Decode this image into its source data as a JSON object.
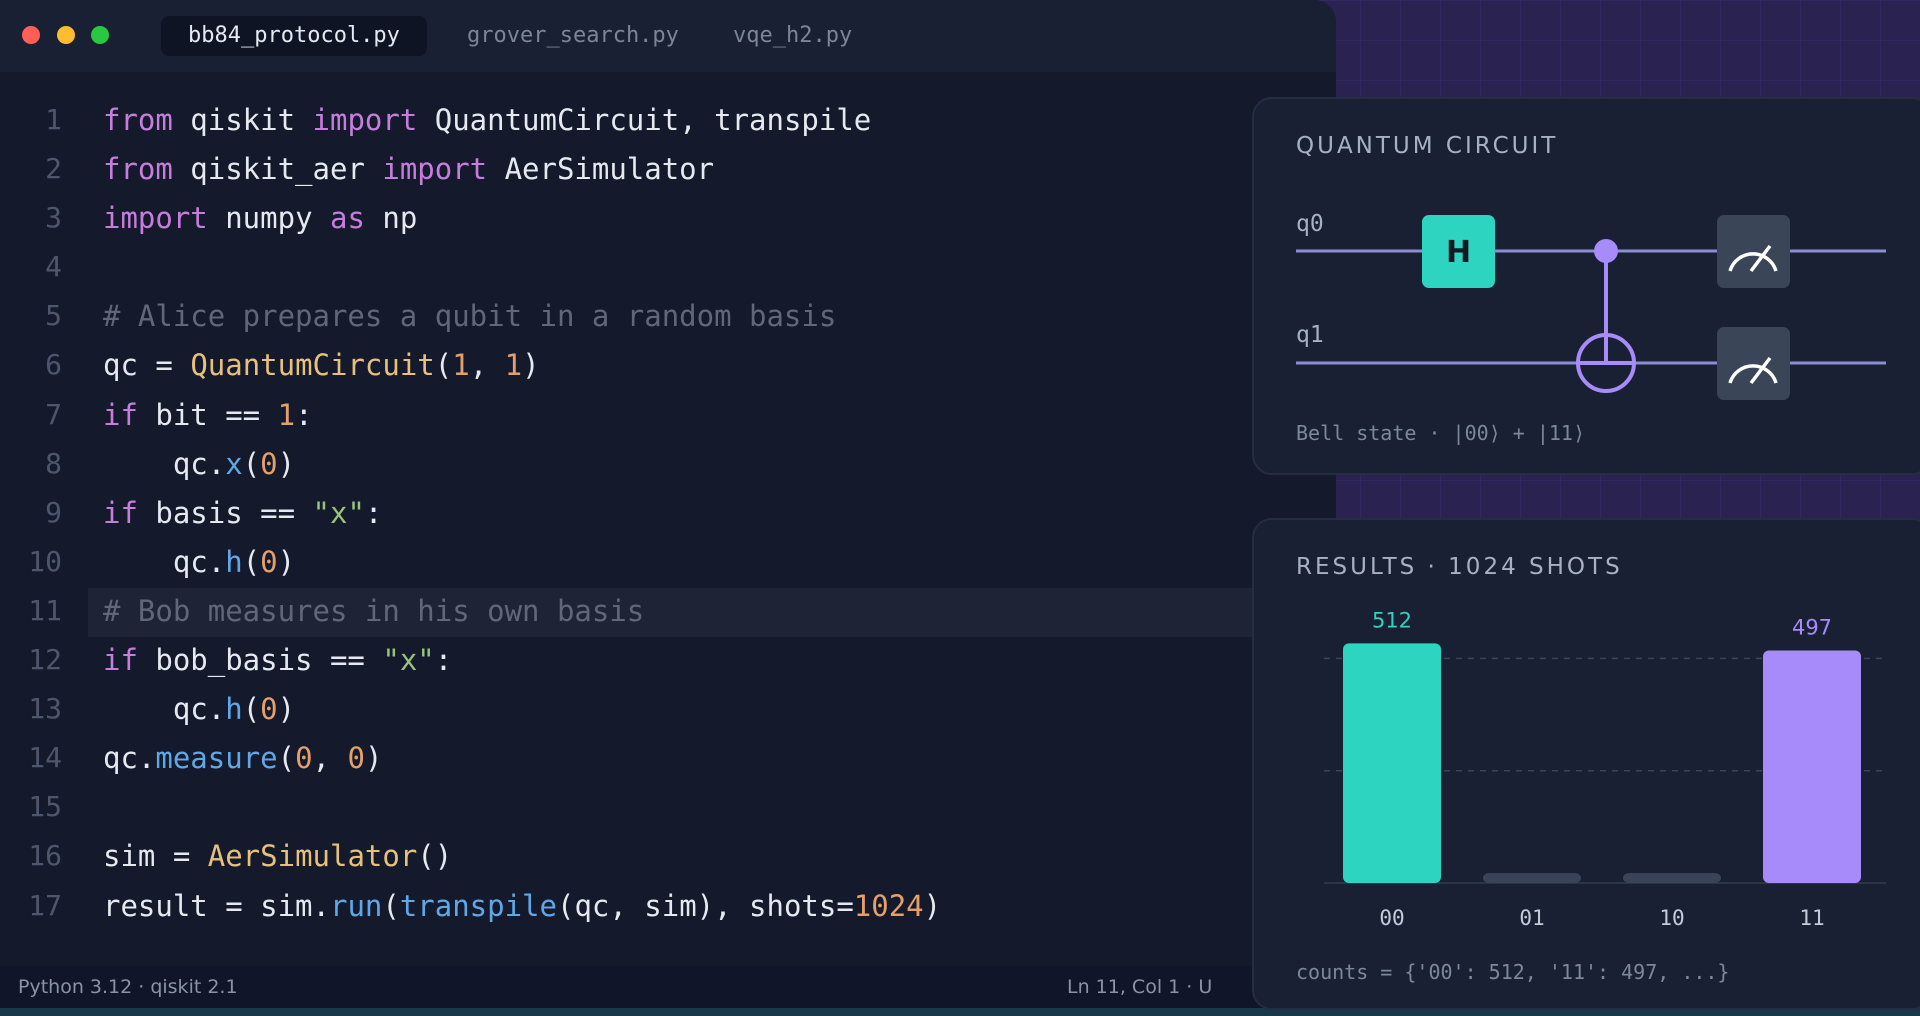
{
  "window": {
    "traffic_lights": [
      "close",
      "minimize",
      "zoom"
    ]
  },
  "tabs": [
    {
      "label": "bb84_protocol.py",
      "active": true
    },
    {
      "label": "grover_search.py",
      "active": false
    },
    {
      "label": "vqe_h2.py",
      "active": false
    }
  ],
  "editor": {
    "highlighted_line": 11,
    "lines": [
      {
        "n": "1",
        "tokens": [
          [
            "kw",
            "from"
          ],
          [
            "t",
            " qiskit "
          ],
          [
            "kw",
            "import"
          ],
          [
            "t",
            " QuantumCircuit, transpile"
          ]
        ]
      },
      {
        "n": "2",
        "tokens": [
          [
            "kw",
            "from"
          ],
          [
            "t",
            " qiskit_aer "
          ],
          [
            "kw",
            "import"
          ],
          [
            "t",
            " AerSimulator"
          ]
        ]
      },
      {
        "n": "3",
        "tokens": [
          [
            "kw",
            "import"
          ],
          [
            "t",
            " numpy "
          ],
          [
            "kw",
            "as"
          ],
          [
            "t",
            " np"
          ]
        ]
      },
      {
        "n": "4",
        "tokens": []
      },
      {
        "n": "5",
        "tokens": [
          [
            "cm",
            "# Alice prepares a qubit in a random basis"
          ]
        ]
      },
      {
        "n": "6",
        "tokens": [
          [
            "t",
            "qc = "
          ],
          [
            "cls",
            "QuantumCircuit"
          ],
          [
            "t",
            "("
          ],
          [
            "num",
            "1"
          ],
          [
            "t",
            ", "
          ],
          [
            "num",
            "1"
          ],
          [
            "t",
            ")"
          ]
        ]
      },
      {
        "n": "7",
        "tokens": [
          [
            "kw",
            "if"
          ],
          [
            "t",
            " bit == "
          ],
          [
            "num",
            "1"
          ],
          [
            "t",
            ":"
          ]
        ]
      },
      {
        "n": "8",
        "tokens": [
          [
            "t",
            "    qc."
          ],
          [
            "fn",
            "x"
          ],
          [
            "t",
            "("
          ],
          [
            "num",
            "0"
          ],
          [
            "t",
            ")"
          ]
        ]
      },
      {
        "n": "9",
        "tokens": [
          [
            "kw",
            "if"
          ],
          [
            "t",
            " basis == "
          ],
          [
            "str",
            "\"x\""
          ],
          [
            "t",
            ":"
          ]
        ]
      },
      {
        "n": "10",
        "tokens": [
          [
            "t",
            "    qc."
          ],
          [
            "fn",
            "h"
          ],
          [
            "t",
            "("
          ],
          [
            "num",
            "0"
          ],
          [
            "t",
            ")"
          ]
        ]
      },
      {
        "n": "11",
        "tokens": [
          [
            "cm",
            "# Bob measures in his own basis"
          ]
        ]
      },
      {
        "n": "12",
        "tokens": [
          [
            "kw",
            "if"
          ],
          [
            "t",
            " bob_basis == "
          ],
          [
            "str",
            "\"x\""
          ],
          [
            "t",
            ":"
          ]
        ]
      },
      {
        "n": "13",
        "tokens": [
          [
            "t",
            "    qc."
          ],
          [
            "fn",
            "h"
          ],
          [
            "t",
            "("
          ],
          [
            "num",
            "0"
          ],
          [
            "t",
            ")"
          ]
        ]
      },
      {
        "n": "14",
        "tokens": [
          [
            "t",
            "qc."
          ],
          [
            "fn",
            "measure"
          ],
          [
            "t",
            "("
          ],
          [
            "num",
            "0"
          ],
          [
            "t",
            ", "
          ],
          [
            "num",
            "0"
          ],
          [
            "t",
            ")"
          ]
        ]
      },
      {
        "n": "15",
        "tokens": []
      },
      {
        "n": "16",
        "tokens": [
          [
            "t",
            "sim = "
          ],
          [
            "cls",
            "AerSimulator"
          ],
          [
            "t",
            "()"
          ]
        ]
      },
      {
        "n": "17",
        "tokens": [
          [
            "t",
            "result = sim."
          ],
          [
            "fn",
            "run"
          ],
          [
            "t",
            "("
          ],
          [
            "fn",
            "transpile"
          ],
          [
            "t",
            "(qc, sim), shots="
          ],
          [
            "num",
            "1024"
          ],
          [
            "t",
            ")"
          ]
        ]
      }
    ]
  },
  "statusbar": {
    "left": "Python 3.12 · qiskit 2.1",
    "right": "Ln 11, Col 1 · U"
  },
  "circuit": {
    "title": "QUANTUM CIRCUIT",
    "qubits": [
      "q0",
      "q1"
    ],
    "gates": [
      {
        "type": "H",
        "label": "H",
        "qubit": "q0"
      },
      {
        "type": "CNOT",
        "control": "q0",
        "target": "q1"
      },
      {
        "type": "measure",
        "qubit": "q0",
        "icon": "meter-icon"
      },
      {
        "type": "measure",
        "qubit": "q1",
        "icon": "meter-icon"
      }
    ],
    "caption": "Bell state · |00⟩ + |11⟩"
  },
  "results": {
    "title": "RESULTS · 1024 SHOTS",
    "caption": "counts = {'00': 512, '11': 497, ...}"
  },
  "chart_data": {
    "type": "bar",
    "title": "RESULTS · 1024 SHOTS",
    "categories": [
      "00",
      "01",
      "10",
      "11"
    ],
    "values": [
      512,
      8,
      7,
      497
    ],
    "value_labels": [
      "512",
      "",
      "",
      "497"
    ],
    "colors": [
      "#2dd4bf",
      "#3a4358",
      "#3a4358",
      "#a78bfa"
    ],
    "ylim": [
      0,
      530
    ],
    "grid": true,
    "grid_values": [
      240,
      480
    ]
  },
  "colors": {
    "accent_teal": "#2dd4bf",
    "accent_purple": "#a78bfa",
    "editor_bg": "#141a2b"
  }
}
